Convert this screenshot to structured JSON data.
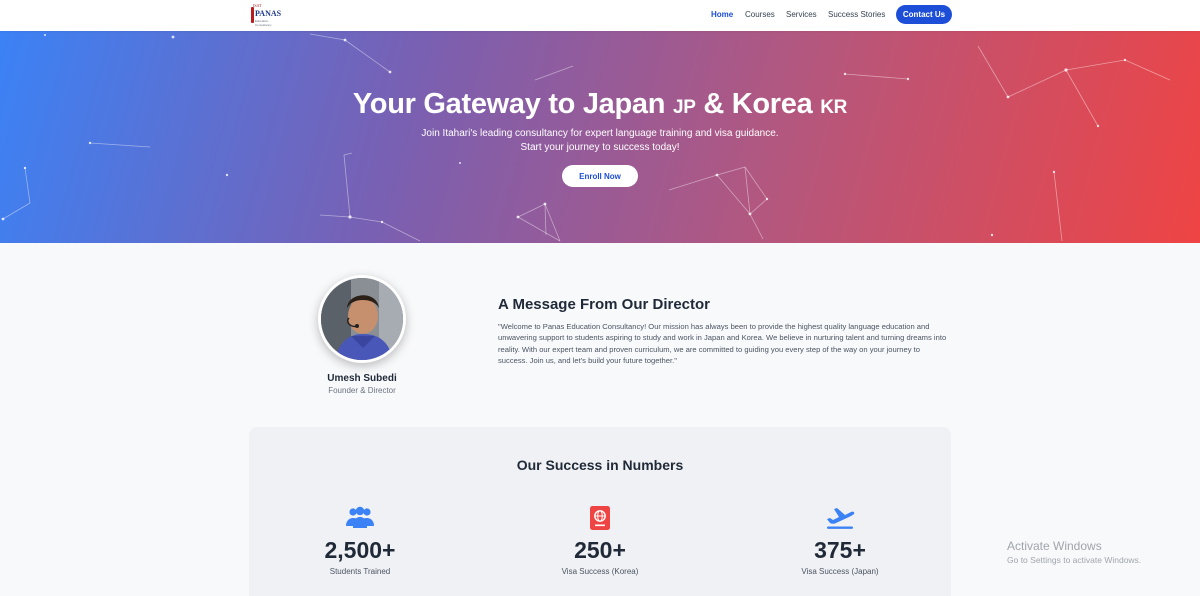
{
  "nav": {
    "logo": {
      "top": "ISAT",
      "main": "PANAS",
      "sub": "Education Consultancy"
    },
    "links": [
      {
        "label": "Home",
        "active": true
      },
      {
        "label": "Courses",
        "active": false
      },
      {
        "label": "Services",
        "active": false
      },
      {
        "label": "Success Stories",
        "active": false
      }
    ],
    "contact_label": "Contact Us"
  },
  "hero": {
    "title_part1": "Your Gateway to Japan",
    "title_tag1": "JP",
    "title_part2": "& Korea",
    "title_tag2": "KR",
    "subtitle_line1": "Join Itahari's leading consultancy for expert language training and visa guidance.",
    "subtitle_line2": "Start your journey to success today!",
    "cta_label": "Enroll Now"
  },
  "director": {
    "section_title": "A Message From Our Director",
    "name": "Umesh Subedi",
    "role": "Founder & Director",
    "message": "\"Welcome to Panas Education Consultancy! Our mission has always been to provide the highest quality language education and unwavering support to students aspiring to study and work in Japan and Korea. We believe in nurturing talent and turning dreams into reality. With our expert team and proven curriculum, we are committed to guiding you every step of the way on your journey to success. Join us, and let's build your future together.\""
  },
  "stats": {
    "title": "Our Success in Numbers",
    "items": [
      {
        "icon": "users-icon",
        "value": "2,500+",
        "label": "Students Trained"
      },
      {
        "icon": "passport-icon",
        "value": "250+",
        "label": "Visa Success (Korea)"
      },
      {
        "icon": "plane-departure-icon",
        "value": "375+",
        "label": "Visa Success (Japan)"
      }
    ]
  },
  "watermark": {
    "line1": "Activate Windows",
    "line2": "Go to Settings to activate Windows."
  },
  "colors": {
    "primary": "#1d4ed8",
    "hero_gradient_start": "#3b82f6",
    "hero_gradient_end": "#ef4444",
    "stat_icon_blue": "#3b82f6",
    "stat_icon_red": "#ef4444"
  }
}
